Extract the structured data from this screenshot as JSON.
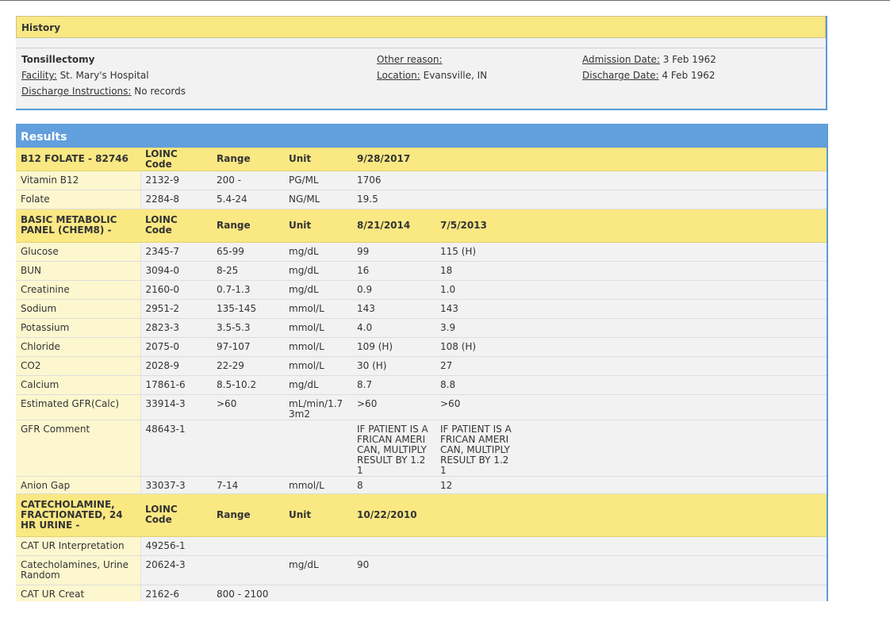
{
  "history": {
    "title": "History",
    "procedure": "Tonsillectomy",
    "facility_label": "Facility:",
    "facility_value": "St. Mary's Hospital",
    "discharge_instr_label": "Discharge Instructions:",
    "discharge_instr_value": "No records",
    "other_reason_label": "Other reason:",
    "location_label": "Location:",
    "location_value": "Evansville, IN",
    "admission_label": "Admission Date:",
    "admission_value": "3 Feb 1962",
    "discharge_date_label": "Discharge Date:",
    "discharge_date_value": "4 Feb 1962"
  },
  "results": {
    "title": "Results",
    "groups": [
      {
        "name": "B12 FOLATE - 82746",
        "h_loinc": "LOINC Code",
        "h_range": "Range",
        "h_unit": "Unit",
        "date1": "9/28/2017",
        "date2": "",
        "rows": [
          {
            "name": "Vitamin B12",
            "loinc": "2132-9",
            "range": "200 -",
            "unit": "PG/ML",
            "v1": "1706",
            "v2": ""
          },
          {
            "name": "Folate",
            "loinc": "2284-8",
            "range": "5.4-24",
            "unit": "NG/ML",
            "v1": "19.5",
            "v2": ""
          }
        ]
      },
      {
        "name": "BASIC METABOLIC PANEL (CHEM8) -",
        "h_loinc": "LOINC Code",
        "h_range": "Range",
        "h_unit": "Unit",
        "date1": "8/21/2014",
        "date2": "7/5/2013",
        "rows": [
          {
            "name": "Glucose",
            "loinc": "2345-7",
            "range": "65-99",
            "unit": "mg/dL",
            "v1": "99",
            "v2": "115 (H)"
          },
          {
            "name": "BUN",
            "loinc": "3094-0",
            "range": "8-25",
            "unit": "mg/dL",
            "v1": "16",
            "v2": "18"
          },
          {
            "name": "Creatinine",
            "loinc": "2160-0",
            "range": "0.7-1.3",
            "unit": "mg/dL",
            "v1": "0.9",
            "v2": "1.0"
          },
          {
            "name": "Sodium",
            "loinc": "2951-2",
            "range": "135-145",
            "unit": "mmol/L",
            "v1": "143",
            "v2": "143"
          },
          {
            "name": "Potassium",
            "loinc": "2823-3",
            "range": "3.5-5.3",
            "unit": "mmol/L",
            "v1": "4.0",
            "v2": "3.9"
          },
          {
            "name": "Chloride",
            "loinc": "2075-0",
            "range": "97-107",
            "unit": "mmol/L",
            "v1": "109 (H)",
            "v2": "108 (H)"
          },
          {
            "name": "CO2",
            "loinc": "2028-9",
            "range": "22-29",
            "unit": "mmol/L",
            "v1": "30 (H)",
            "v2": "27"
          },
          {
            "name": "Calcium",
            "loinc": "17861-6",
            "range": "8.5-10.2",
            "unit": "mg/dL",
            "v1": "8.7",
            "v2": "8.8"
          },
          {
            "name": "Estimated GFR(Calc)",
            "loinc": "33914-3",
            "range": ">60",
            "unit": "mL/min/1.73m2",
            "v1": ">60",
            "v2": ">60"
          },
          {
            "name": "GFR Comment",
            "loinc": "48643-1",
            "range": "",
            "unit": "",
            "v1": "IF PATIENT IS AFRICAN AMERICAN, MULTIPLY RESULT BY 1.21",
            "v2": "IF PATIENT IS AFRICAN AMERICAN, MULTIPLY RESULT BY 1.21"
          },
          {
            "name": "Anion Gap",
            "loinc": "33037-3",
            "range": "7-14",
            "unit": "mmol/L",
            "v1": "8",
            "v2": "12"
          }
        ]
      },
      {
        "name": "CATECHOLAMINE, FRACTIONATED, 24 HR URINE -",
        "h_loinc": "LOINC Code",
        "h_range": "Range",
        "h_unit": "Unit",
        "date1": "10/22/2010",
        "date2": "",
        "rows": [
          {
            "name": "CAT UR Interpretation",
            "loinc": "49256-1",
            "range": "",
            "unit": "",
            "v1": "",
            "v2": ""
          },
          {
            "name": "Catecholamines, Urine Random",
            "loinc": "20624-3",
            "range": "",
            "unit": "mg/dL",
            "v1": "90",
            "v2": ""
          },
          {
            "name": "CAT UR Creat",
            "loinc": "2162-6",
            "range": "800 - 2100",
            "unit": "",
            "v1": "",
            "v2": ""
          }
        ]
      }
    ]
  }
}
